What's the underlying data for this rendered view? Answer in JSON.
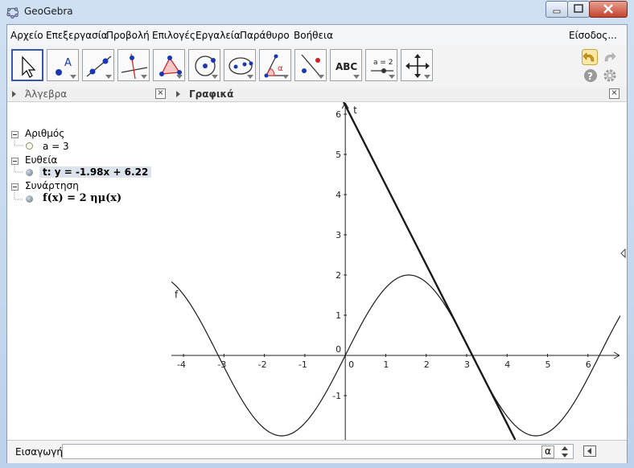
{
  "window": {
    "title": "GeoGebra"
  },
  "menu": {
    "items": [
      "Αρχείο",
      "Επεξεργασία",
      "Προβολή",
      "Επιλογές",
      "Εργαλεία",
      "Παράθυρο",
      "Βοήθεια"
    ],
    "signin": "Είσοδος..."
  },
  "toolbar": {
    "tools": [
      "move-tool",
      "point-tool",
      "line-tool",
      "perpendicular-tool",
      "polygon-tool",
      "circle-tool",
      "ellipse-tool",
      "angle-tool",
      "reflect-tool",
      "text-tool",
      "slider-tool",
      "move-view-tool"
    ],
    "text_tool_label": "ABC",
    "slider_tool_label": "a = 2"
  },
  "algebra": {
    "title": "Άλγεβρα",
    "groups": [
      {
        "name": "Αριθμός",
        "items": [
          "a = 3"
        ]
      },
      {
        "name": "Ευθεία",
        "items": [
          "t: y = -1.98x + 6.22"
        ]
      },
      {
        "name": "Συνάρτηση",
        "items": [
          "f(x) = 2 ημ(x)"
        ]
      }
    ]
  },
  "graphics": {
    "title": "Γραφικά",
    "x_ticks": [
      "-4",
      "-3",
      "-2",
      "-1",
      "0",
      "1",
      "2",
      "3",
      "4",
      "5",
      "6"
    ],
    "y_ticks": [
      "6",
      "5",
      "4",
      "3",
      "2",
      "1",
      "0",
      "-1"
    ],
    "function_label": "f",
    "line_label": "t"
  },
  "input": {
    "label": "Εισαγωγή:",
    "value": "",
    "alpha_button": "α"
  },
  "chart_data": {
    "type": "line",
    "xlim": [
      -4.3,
      6.8
    ],
    "ylim": [
      -2.1,
      6.3
    ],
    "grid": false,
    "series": [
      {
        "name": "f",
        "formula": "2 sin(x)"
      },
      {
        "name": "t",
        "slope": -1.98,
        "intercept": 6.22
      }
    ]
  }
}
